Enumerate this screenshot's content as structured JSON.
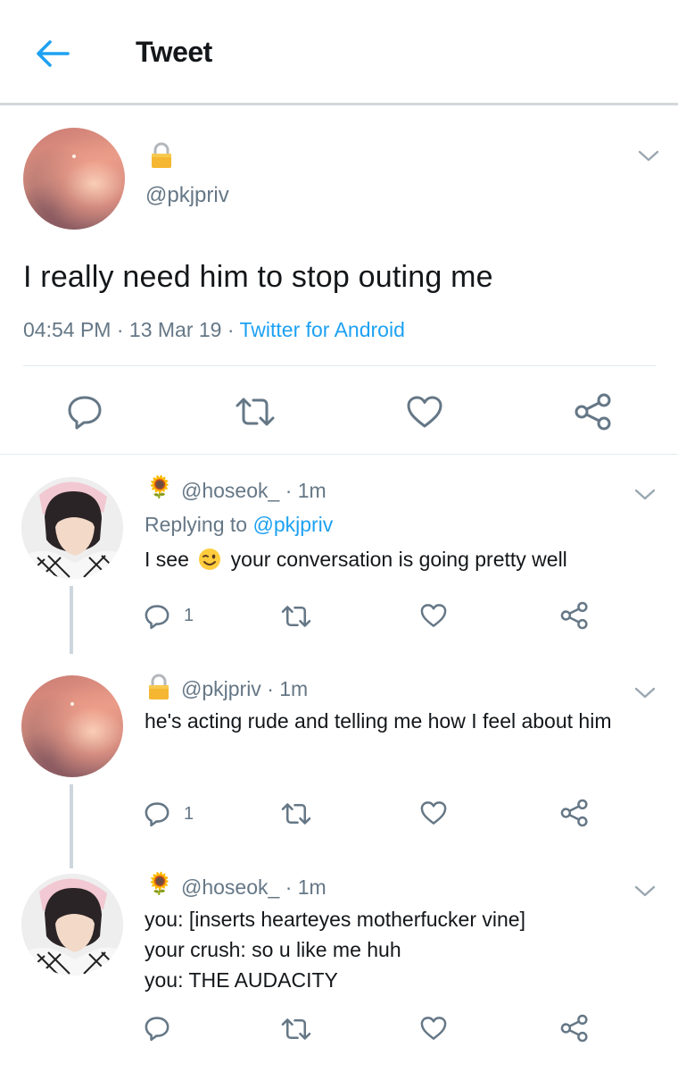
{
  "header": {
    "title": "Tweet"
  },
  "main_tweet": {
    "handle": "@pkjpriv",
    "text": "I really need him to stop outing me",
    "time": "04:54 PM",
    "date": "13 Mar 19",
    "source": "Twitter for Android",
    "meta_sep": " · "
  },
  "replies": [
    {
      "handle": "@hoseok_",
      "age": "1m",
      "replying_prefix": "Replying to ",
      "replying_to": "@pkjpriv",
      "text_before_emoji": "I see",
      "text_after_emoji": "your conversation is going pretty well",
      "reply_count": "1"
    },
    {
      "handle": "@pkjpriv",
      "age": "1m",
      "text": "he's acting rude and telling me how I feel about him",
      "reply_count": "1"
    },
    {
      "handle": "@hoseok_",
      "age": "1m",
      "lines": [
        "you: [inserts hearteyes motherfucker vine]",
        "your crush: so u like me huh",
        "you: THE AUDACITY"
      ]
    }
  ],
  "sep": " · ",
  "icons": {
    "back": "back-arrow-icon",
    "lock": "lock-icon",
    "flower": "sunflower-icon",
    "chevron": "chevron-down-icon",
    "reply": "reply-icon",
    "retweet": "retweet-icon",
    "like": "heart-icon",
    "share": "share-icon",
    "wink": "wink-emoji-icon"
  },
  "colors": {
    "accent": "#1da1f2",
    "text": "#14171a",
    "muted": "#657786",
    "icon": "#657786",
    "divider": "#e6ecf0"
  }
}
